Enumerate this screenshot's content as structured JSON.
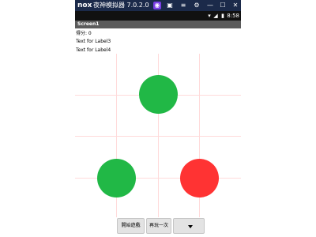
{
  "window": {
    "logo": "nox",
    "title": "夜神模拟器 7.0.2.0",
    "icons": [
      "user-icon",
      "keyboard-icon",
      "menu-icon",
      "settings-icon",
      "minimize-icon",
      "maximize-icon",
      "close-icon"
    ]
  },
  "status_bar": {
    "time": "8:58"
  },
  "screen": {
    "title": "Screen1",
    "score_label": "得分: 0",
    "label3": "Text for Label3",
    "label4": "Text for Label4"
  },
  "balls": [
    {
      "name": "top-green-ball",
      "color": "#21b846"
    },
    {
      "name": "bottom-left-green-ball",
      "color": "#21b846"
    },
    {
      "name": "bottom-right-red-ball",
      "color": "#ff3333"
    }
  ],
  "buttons": {
    "start_game": "開始遊戲",
    "play_again": "再玩一次"
  },
  "colors": {
    "green": "#21b846",
    "red": "#ff3333",
    "grid": "#ffdada"
  }
}
